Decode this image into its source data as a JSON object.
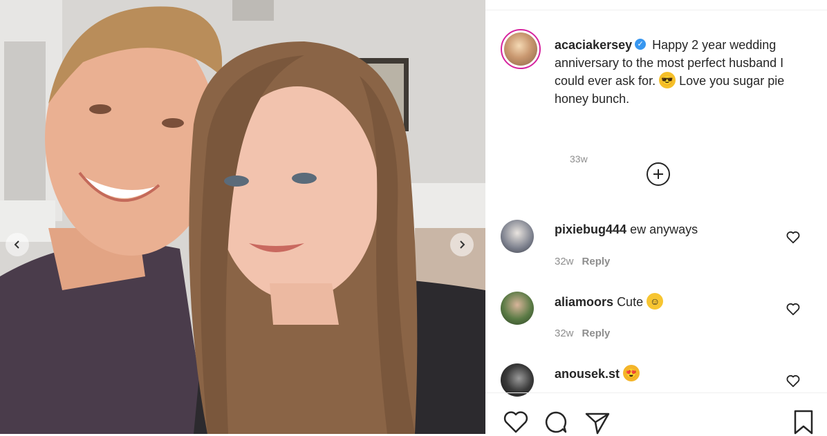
{
  "carousel": {
    "prev_icon": "chevron-left-icon",
    "next_icon": "chevron-right-icon"
  },
  "post": {
    "username": "acaciakersey",
    "verified": true,
    "caption_part1": "Happy 2 year wedding anniversary to the most perfect husband I could ever ask for.",
    "caption_part2": "Love you sugar pie honey bunch.",
    "emoji_name": "face-with-sunglasses-emoji",
    "time": "33w"
  },
  "load_more_icon": "plus-circle-icon",
  "comments": [
    {
      "username": "pixiebug444",
      "text": "ew anyways",
      "time": "32w",
      "reply_label": "Reply",
      "avatar_color": "#6b6f7d"
    },
    {
      "username": "aliamoors",
      "text": "Cute",
      "emoji_name": "smiling-face-emoji",
      "time": "32w",
      "reply_label": "Reply",
      "avatar_color": "#4a6b3a"
    },
    {
      "username": "anousek.st",
      "text": "",
      "emoji_name": "heart-eyes-emoji",
      "avatar_color": "#2a2a2a"
    }
  ],
  "actions": {
    "like_icon": "heart-icon",
    "comment_icon": "comment-icon",
    "share_icon": "paper-plane-icon",
    "save_icon": "bookmark-icon"
  },
  "colors": {
    "text": "#262626",
    "muted": "#8e8e8e",
    "verified": "#3897f0",
    "story_ring": "#d6249f"
  }
}
